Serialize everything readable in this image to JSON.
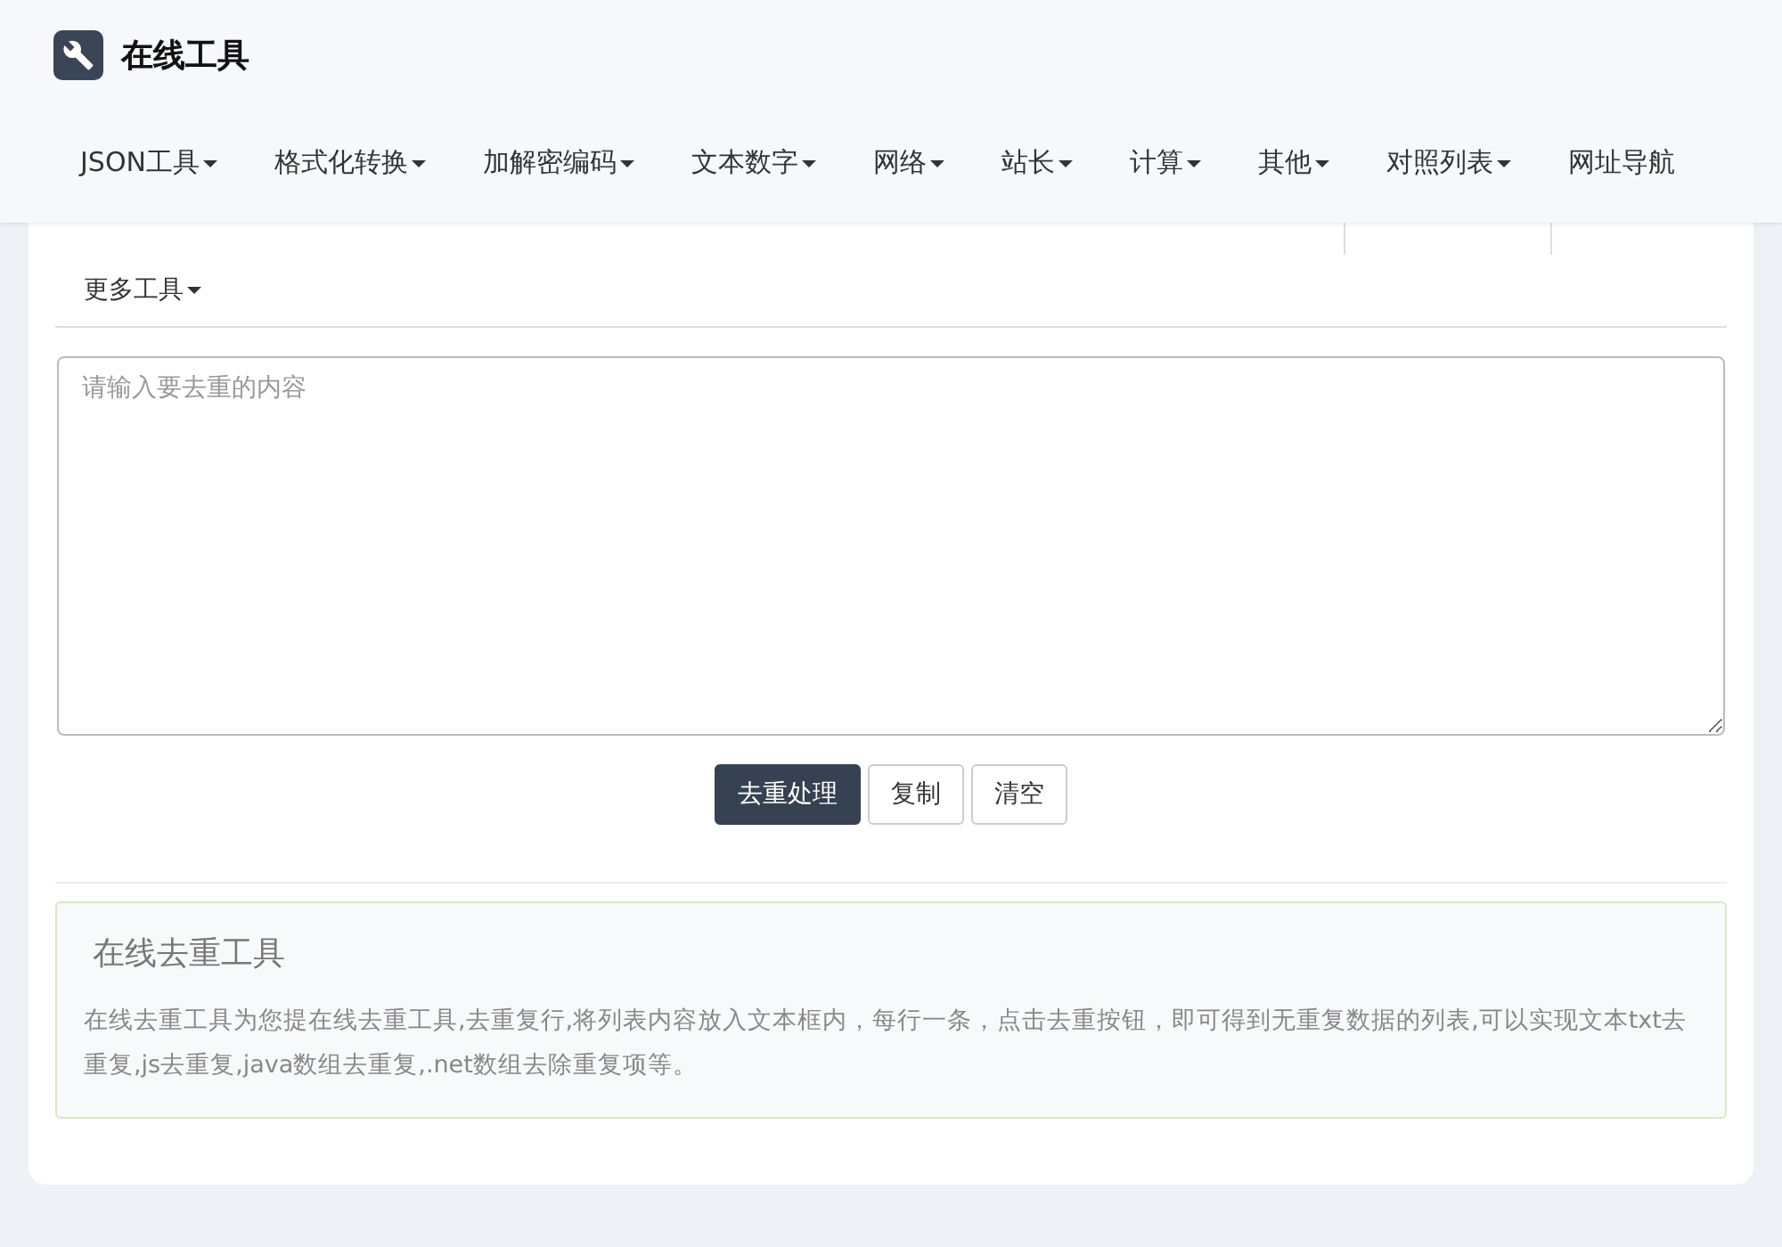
{
  "header": {
    "title": "在线工具"
  },
  "nav": [
    {
      "label": "JSON工具",
      "dropdown": true
    },
    {
      "label": "格式化转换",
      "dropdown": true
    },
    {
      "label": "加解密编码",
      "dropdown": true
    },
    {
      "label": "文本数字",
      "dropdown": true
    },
    {
      "label": "网络",
      "dropdown": true
    },
    {
      "label": "站长",
      "dropdown": true
    },
    {
      "label": "计算",
      "dropdown": true
    },
    {
      "label": "其他",
      "dropdown": true
    },
    {
      "label": "对照列表",
      "dropdown": true
    },
    {
      "label": "网址导航",
      "dropdown": false
    }
  ],
  "more_tools": {
    "label": "更多工具",
    "dropdown": true
  },
  "editor": {
    "placeholder": "请输入要去重的内容"
  },
  "buttons": [
    {
      "label": "去重处理",
      "kind": "primary"
    },
    {
      "label": "复制",
      "kind": "default"
    },
    {
      "label": "清空",
      "kind": "default"
    }
  ],
  "info": {
    "title": "在线去重工具",
    "text": "在线去重工具为您提在线去重工具,去重复行,将列表内容放入文本框内，每行一条，点击去重按钮，即可得到无重复数据的列表,可以实现文本txt去重复,js去重复,java数组去重复,.net数组去除重复项等。"
  }
}
